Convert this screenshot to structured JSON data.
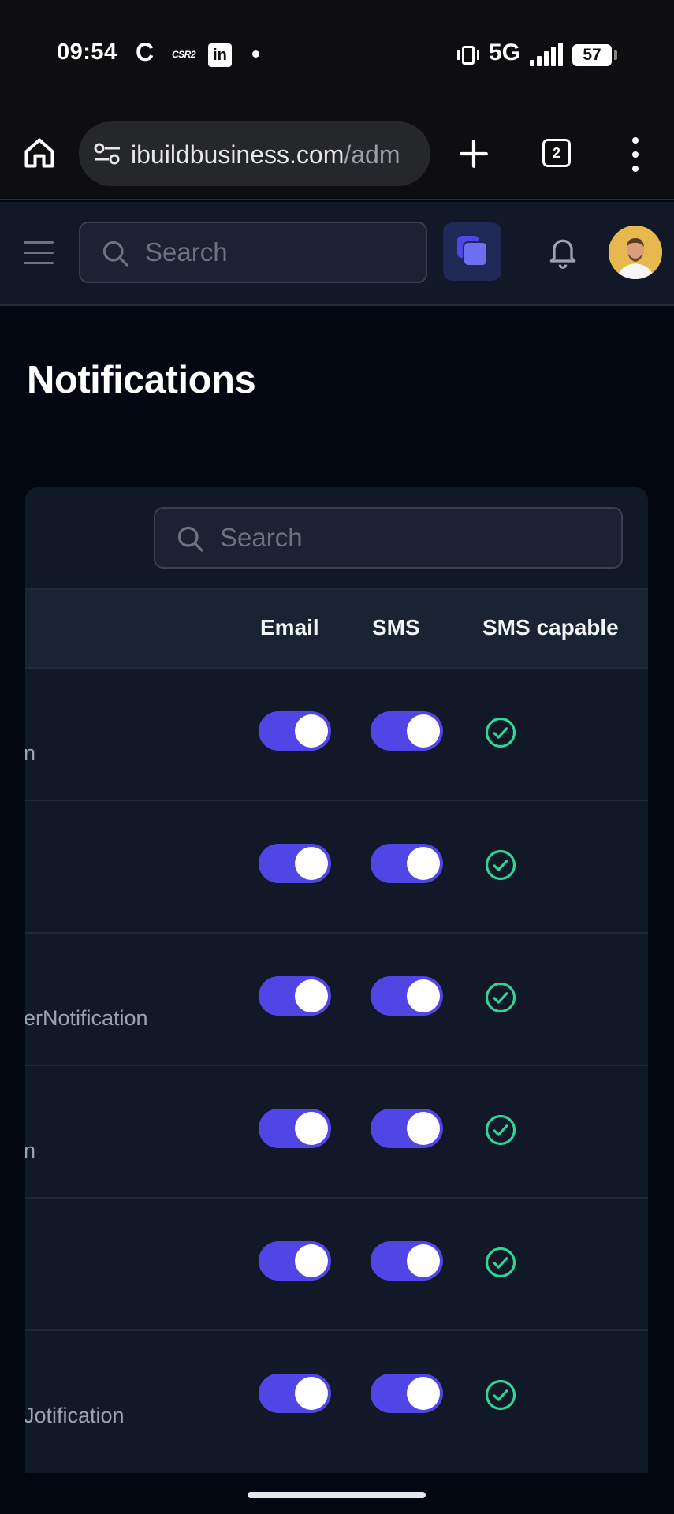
{
  "status_bar": {
    "time": "09:54",
    "c_label": "C",
    "csr_label": "CSR2",
    "linkedin_label": "in",
    "network": "5G",
    "battery": "57"
  },
  "browser": {
    "url_host": "ibuildbusiness.com",
    "url_path": "/adm",
    "tab_count": "2"
  },
  "header": {
    "search_placeholder": "Search"
  },
  "page": {
    "title": "Notifications"
  },
  "table": {
    "search_placeholder": "Search",
    "columns": {
      "email": "Email",
      "sms": "SMS",
      "sms_capable": "SMS capable"
    },
    "rows": [
      {
        "name": "n",
        "email": true,
        "sms": true,
        "sms_capable": true
      },
      {
        "name": "",
        "email": true,
        "sms": true,
        "sms_capable": true
      },
      {
        "name": "erNotification",
        "email": true,
        "sms": true,
        "sms_capable": true
      },
      {
        "name": "n",
        "email": true,
        "sms": true,
        "sms_capable": true
      },
      {
        "name": "",
        "email": true,
        "sms": true,
        "sms_capable": true
      },
      {
        "name": "Jotification",
        "email": true,
        "sms": true,
        "sms_capable": true
      }
    ]
  },
  "colors": {
    "toggle_on": "#4f46e5",
    "check": "#34d399",
    "card_bg": "#111827",
    "page_bg": "#030712"
  },
  "icons": {
    "home": "home-icon",
    "tune": "tune-icon",
    "plus": "plus-icon",
    "tabs": "tabs-icon",
    "menu": "more-vert-icon",
    "hamburger": "menu-icon",
    "search": "search-icon",
    "apps": "copy-icon",
    "bell": "bell-icon",
    "check": "check-circle-icon"
  }
}
